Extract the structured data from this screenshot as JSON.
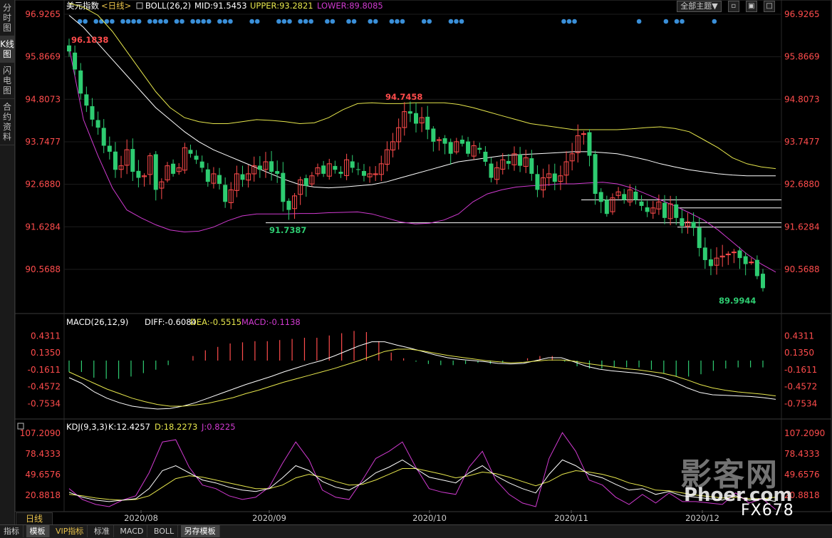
{
  "sidebar": {
    "tabs": [
      {
        "label": "分时图",
        "active": false
      },
      {
        "label": "K线图",
        "active": true
      },
      {
        "label": "闪电图",
        "active": false
      },
      {
        "label": "合约资料",
        "active": false
      }
    ]
  },
  "header": {
    "main_name": "美元指数",
    "main_period": "<日线>",
    "boll_label": "BOLL(26,2)",
    "mid": "MID:91.5453",
    "upper": "UPPER:93.2821",
    "lower": "LOWER:89.8085",
    "theme_label": "全部主题▼"
  },
  "macd_header": {
    "label": "MACD(26,12,9)",
    "diff": "DIFF:-0.6084",
    "dea": "DEA:-0.5515",
    "macd": "MACD:-0.1138"
  },
  "kdj_header": {
    "label": "KDJ(9,3,3)",
    "k": "K:12.4257",
    "d": "D:18.2273",
    "j": "J:0.8225"
  },
  "bottom_tabs": [
    "指标",
    "模板",
    "VIP指标",
    "标准",
    "MACD",
    "BOLL",
    "另存模板"
  ],
  "period_button": "日线",
  "watermark": {
    "cn": "影客网",
    "en": "Phoer.com",
    "code": "FX678"
  },
  "colors": {
    "up": "#ff4c4c",
    "down": "#2ecc71",
    "mid": "#ffffff",
    "upper": "#e6e64c",
    "lower": "#d03ad0",
    "dea": "#e6e64c",
    "kdj_j": "#d03ad0",
    "marker": "#3a8fd8"
  },
  "chart_data": [
    {
      "type": "candlestick",
      "title": "美元指数 <日线>",
      "y_ticks": [
        "96.9265",
        "95.8669",
        "94.8073",
        "93.7477",
        "92.6880",
        "91.6284",
        "90.5688"
      ],
      "ylim": [
        90.0,
        96.9265
      ],
      "x_ticks": [
        "2020/08",
        "2020/09",
        "2020/10",
        "2020/11",
        "2020/12"
      ],
      "annotations": [
        {
          "text": "96.1838",
          "kind": "high"
        },
        {
          "text": "94.7458",
          "kind": "high"
        },
        {
          "text": "91.7387",
          "kind": "low"
        },
        {
          "text": "89.9944",
          "kind": "low"
        }
      ],
      "closes": [
        96.0,
        95.55,
        94.95,
        94.65,
        94.3,
        94.1,
        93.65,
        93.5,
        93.05,
        93.15,
        93.55,
        93.0,
        92.85,
        92.9,
        93.4,
        92.55,
        92.75,
        93.15,
        92.95,
        93.1,
        93.6,
        93.45,
        93.3,
        93.1,
        92.75,
        92.95,
        92.7,
        92.25,
        92.55,
        92.95,
        92.8,
        92.95,
        93.15,
        93.05,
        93.25,
        93.0,
        92.95,
        92.25,
        92.05,
        92.4,
        92.8,
        92.65,
        92.9,
        93.1,
        92.95,
        93.2,
        93.05,
        92.95,
        93.3,
        93.1,
        93.05,
        92.9,
        92.95,
        92.95,
        93.2,
        93.55,
        93.75,
        94.1,
        94.5,
        94.45,
        94.2,
        94.35,
        94.05,
        93.75,
        93.8,
        93.7,
        93.45,
        93.75,
        93.7,
        93.45,
        93.65,
        93.55,
        93.25,
        92.85,
        93.1,
        93.3,
        93.2,
        93.45,
        93.15,
        93.35,
        92.95,
        92.55,
        92.85,
        92.95,
        92.75,
        92.9,
        93.25,
        93.45,
        93.9,
        93.95,
        93.4,
        92.45,
        92.25,
        91.95,
        92.35,
        92.5,
        92.3,
        92.55,
        92.3,
        92.15,
        92.0,
        92.1,
        92.25,
        91.85,
        92.2,
        91.85,
        91.65,
        91.75,
        91.6,
        91.1,
        90.8,
        90.65,
        90.85,
        90.9,
        90.95,
        91.0,
        90.85,
        90.7,
        90.75,
        90.4,
        90.1
      ],
      "bands": {
        "mid": [
          96.9,
          96.6,
          96.2,
          95.8,
          95.4,
          95.0,
          94.6,
          94.3,
          94.0,
          93.75,
          93.55,
          93.4,
          93.25,
          93.1,
          92.95,
          92.8,
          92.68,
          92.62,
          92.6,
          92.62,
          92.65,
          92.68,
          92.75,
          92.85,
          92.95,
          93.05,
          93.15,
          93.25,
          93.3,
          93.35,
          93.4,
          93.42,
          93.44,
          93.46,
          93.48,
          93.5,
          93.5,
          93.48,
          93.45,
          93.38,
          93.3,
          93.2,
          93.12,
          93.05,
          93.0,
          92.95,
          92.92,
          92.9,
          92.9,
          92.9
        ],
        "upper": [
          97.2,
          97.1,
          96.9,
          96.5,
          96.0,
          95.5,
          95.0,
          94.6,
          94.35,
          94.25,
          94.2,
          94.2,
          94.25,
          94.3,
          94.28,
          94.25,
          94.2,
          94.22,
          94.35,
          94.55,
          94.7,
          94.72,
          94.7,
          94.7,
          94.72,
          94.72,
          94.72,
          94.68,
          94.6,
          94.5,
          94.4,
          94.3,
          94.2,
          94.15,
          94.1,
          94.05,
          94.05,
          94.05,
          94.05,
          94.07,
          94.1,
          94.12,
          94.08,
          94.0,
          93.8,
          93.6,
          93.35,
          93.2,
          93.12,
          93.08
        ],
        "lower": [
          96.1,
          94.3,
          93.4,
          92.6,
          92.05,
          91.85,
          91.68,
          91.55,
          91.5,
          91.52,
          91.62,
          91.78,
          91.9,
          91.95,
          91.95,
          91.95,
          91.96,
          91.96,
          91.98,
          91.99,
          92.0,
          91.95,
          91.85,
          91.75,
          91.7,
          91.72,
          91.8,
          91.95,
          92.25,
          92.45,
          92.55,
          92.62,
          92.65,
          92.67,
          92.7,
          92.7,
          92.72,
          92.74,
          92.7,
          92.6,
          92.45,
          92.3,
          92.15,
          91.98,
          91.8,
          91.55,
          91.25,
          90.95,
          90.7,
          90.5
        ]
      }
    },
    {
      "type": "bar",
      "title": "MACD(26,12,9)",
      "y_ticks": [
        "0.4311",
        "0.1350",
        "-0.1611",
        "-0.4572",
        "-0.7534"
      ],
      "ylim": [
        -0.9,
        0.55
      ],
      "diff": [
        -0.3,
        -0.4,
        -0.55,
        -0.66,
        -0.74,
        -0.8,
        -0.83,
        -0.85,
        -0.84,
        -0.8,
        -0.74,
        -0.66,
        -0.58,
        -0.5,
        -0.42,
        -0.35,
        -0.28,
        -0.2,
        -0.13,
        -0.06,
        0.0,
        0.08,
        0.17,
        0.26,
        0.33,
        0.33,
        0.27,
        0.22,
        0.16,
        0.1,
        0.05,
        0.02,
        0.0,
        -0.02,
        -0.05,
        -0.06,
        -0.05,
        0.0,
        0.05,
        0.05,
        -0.02,
        -0.1,
        -0.15,
        -0.18,
        -0.2,
        -0.22,
        -0.25,
        -0.3,
        -0.38,
        -0.48,
        -0.56,
        -0.6,
        -0.61,
        -0.62,
        -0.63,
        -0.65,
        -0.68
      ],
      "dea": [
        -0.2,
        -0.3,
        -0.4,
        -0.5,
        -0.58,
        -0.66,
        -0.72,
        -0.77,
        -0.8,
        -0.8,
        -0.78,
        -0.75,
        -0.7,
        -0.65,
        -0.58,
        -0.52,
        -0.45,
        -0.38,
        -0.32,
        -0.26,
        -0.2,
        -0.14,
        -0.07,
        0.0,
        0.08,
        0.16,
        0.2,
        0.2,
        0.17,
        0.13,
        0.09,
        0.06,
        0.03,
        0.0,
        -0.02,
        -0.04,
        -0.03,
        -0.01,
        0.01,
        0.01,
        -0.01,
        -0.05,
        -0.08,
        -0.11,
        -0.14,
        -0.16,
        -0.19,
        -0.22,
        -0.27,
        -0.34,
        -0.42,
        -0.48,
        -0.52,
        -0.55,
        -0.57,
        -0.59,
        -0.62
      ],
      "hist": [
        -0.2,
        -0.2,
        -0.3,
        -0.32,
        -0.32,
        -0.28,
        -0.22,
        -0.16,
        -0.08,
        0.0,
        0.08,
        0.18,
        0.24,
        0.3,
        0.32,
        0.34,
        0.34,
        0.36,
        0.38,
        0.4,
        0.4,
        0.44,
        0.48,
        0.52,
        0.5,
        0.34,
        0.14,
        0.04,
        -0.02,
        -0.06,
        -0.08,
        -0.08,
        -0.06,
        -0.04,
        -0.06,
        -0.04,
        0.0,
        0.04,
        0.08,
        0.08,
        -0.02,
        -0.1,
        -0.14,
        -0.14,
        -0.12,
        -0.12,
        -0.12,
        -0.16,
        -0.22,
        -0.28,
        -0.28,
        -0.24,
        -0.18,
        -0.14,
        -0.12,
        -0.12,
        -0.12
      ]
    },
    {
      "type": "line",
      "title": "KDJ(9,3,3)",
      "y_ticks": [
        "107.2090",
        "78.4333",
        "49.6576",
        "20.8818"
      ],
      "ylim": [
        0,
        115
      ],
      "k": [
        25,
        18,
        14,
        12,
        14,
        16,
        30,
        55,
        62,
        52,
        42,
        38,
        32,
        28,
        26,
        30,
        45,
        62,
        55,
        40,
        32,
        28,
        38,
        52,
        60,
        70,
        58,
        46,
        42,
        38,
        52,
        62,
        48,
        38,
        30,
        24,
        50,
        70,
        62,
        50,
        45,
        36,
        28,
        30,
        22,
        26,
        20,
        18,
        16,
        14,
        20,
        14,
        16,
        12
      ],
      "d": [
        22,
        20,
        17,
        15,
        14,
        15,
        20,
        32,
        44,
        48,
        46,
        42,
        38,
        34,
        30,
        30,
        35,
        45,
        50,
        46,
        40,
        35,
        36,
        42,
        50,
        58,
        58,
        54,
        50,
        45,
        48,
        53,
        51,
        46,
        40,
        34,
        40,
        50,
        55,
        53,
        50,
        45,
        38,
        34,
        28,
        27,
        24,
        21,
        19,
        17,
        18,
        16,
        16,
        18
      ],
      "j": [
        30,
        15,
        8,
        5,
        14,
        20,
        52,
        95,
        98,
        60,
        35,
        30,
        20,
        15,
        18,
        32,
        65,
        95,
        70,
        28,
        18,
        15,
        42,
        72,
        82,
        95,
        60,
        30,
        25,
        22,
        60,
        82,
        42,
        22,
        10,
        5,
        72,
        108,
        82,
        42,
        35,
        18,
        8,
        22,
        10,
        24,
        12,
        12,
        10,
        8,
        24,
        10,
        16,
        1
      ]
    }
  ]
}
